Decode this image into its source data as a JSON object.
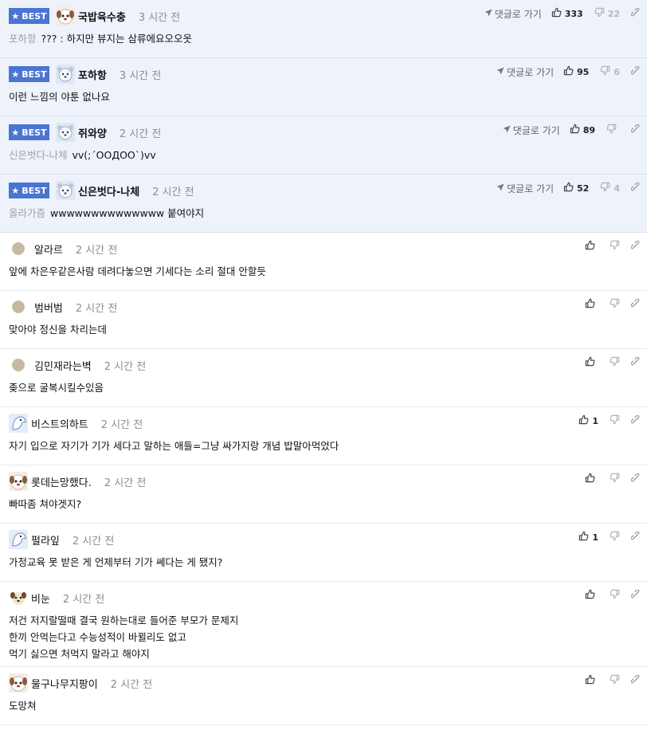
{
  "best_label": "BEST",
  "goto_label": "댓글로 가기",
  "best_comments": [
    {
      "nick": "국밥육수충",
      "time": "3 시간 전",
      "reply_to": "포하항",
      "text": "??? : 하지만 뷰지는 삼류에요오오옷",
      "likes": "333",
      "dislikes": "22",
      "avatar": "dog"
    },
    {
      "nick": "포하항",
      "time": "3 시간 전",
      "reply_to": "",
      "text": "이런 느낌의 야툰 없나요",
      "likes": "95",
      "dislikes": "6",
      "avatar": "bear"
    },
    {
      "nick": "쥐와양",
      "time": "2 시간 전",
      "reply_to": "신은벗다-나체",
      "text": "vv(;´ΟΟДΟΟ`)vv",
      "likes": "89",
      "dislikes": "",
      "avatar": "bear"
    },
    {
      "nick": "신은벗다-나체",
      "time": "2 시간 전",
      "reply_to": "올라가즘",
      "text": "wwwwwwwwwwwwww 붙여야지",
      "likes": "52",
      "dislikes": "4",
      "avatar": "bear"
    }
  ],
  "comments": [
    {
      "nick": "알라르",
      "time": "2 시간 전",
      "lines": [
        "앞에 차은우같은사람 데려다놓으면 기세다는 소리 절대 안할듯"
      ],
      "likes": "",
      "avatar": "dot"
    },
    {
      "nick": "범버범",
      "time": "2 시간 전",
      "lines": [
        "맞아야 정신을 차리는데"
      ],
      "likes": "",
      "avatar": "dot"
    },
    {
      "nick": "김민재라는벽",
      "time": "2 시간 전",
      "lines": [
        "좆으로 굴복시킬수있음"
      ],
      "likes": "",
      "avatar": "dot"
    },
    {
      "nick": "비스트의하트",
      "time": "2 시간 전",
      "lines": [
        "자기 입으로 자기가 기가 세다고 말하는 애들=그냥 싸가지랑 개념 밥말아먹었다"
      ],
      "likes": "1",
      "avatar": "bird"
    },
    {
      "nick": "롯데는망했다.",
      "time": "2 시간 전",
      "lines": [
        "빠따좀 쳐야겟지?"
      ],
      "likes": "",
      "avatar": "dog"
    },
    {
      "nick": "펄라잎",
      "time": "2 시간 전",
      "lines": [
        "가정교육 못 받은 게 언제부터 기가 쎄다는 게 됐지?"
      ],
      "likes": "1",
      "avatar": "bird"
    },
    {
      "nick": "비눈",
      "time": "2 시간 전",
      "lines": [
        "저건 저지랄떨때 결국 원하는대로 들어준 부모가 문제지",
        "한끼 안먹는다고 수능성적이 바뀔리도 없고",
        "먹기 싫으면 처먹지 말라고 해야지"
      ],
      "likes": "",
      "avatar": "puppy"
    },
    {
      "nick": "물구나무지팡이",
      "time": "2 시간 전",
      "lines": [
        "도망쳐"
      ],
      "likes": "",
      "avatar": "dog"
    }
  ]
}
